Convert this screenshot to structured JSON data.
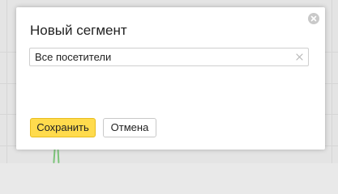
{
  "dialog": {
    "title": "Новый сегмент",
    "segment_name_value": "Все посетители",
    "save_label": "Сохранить",
    "cancel_label": "Отмена"
  },
  "icons": {
    "close": "close-circle-icon",
    "clear": "clear-x-icon"
  },
  "colors": {
    "primary_button": "#ffdb4d",
    "chart_line": "#7cc47a"
  }
}
